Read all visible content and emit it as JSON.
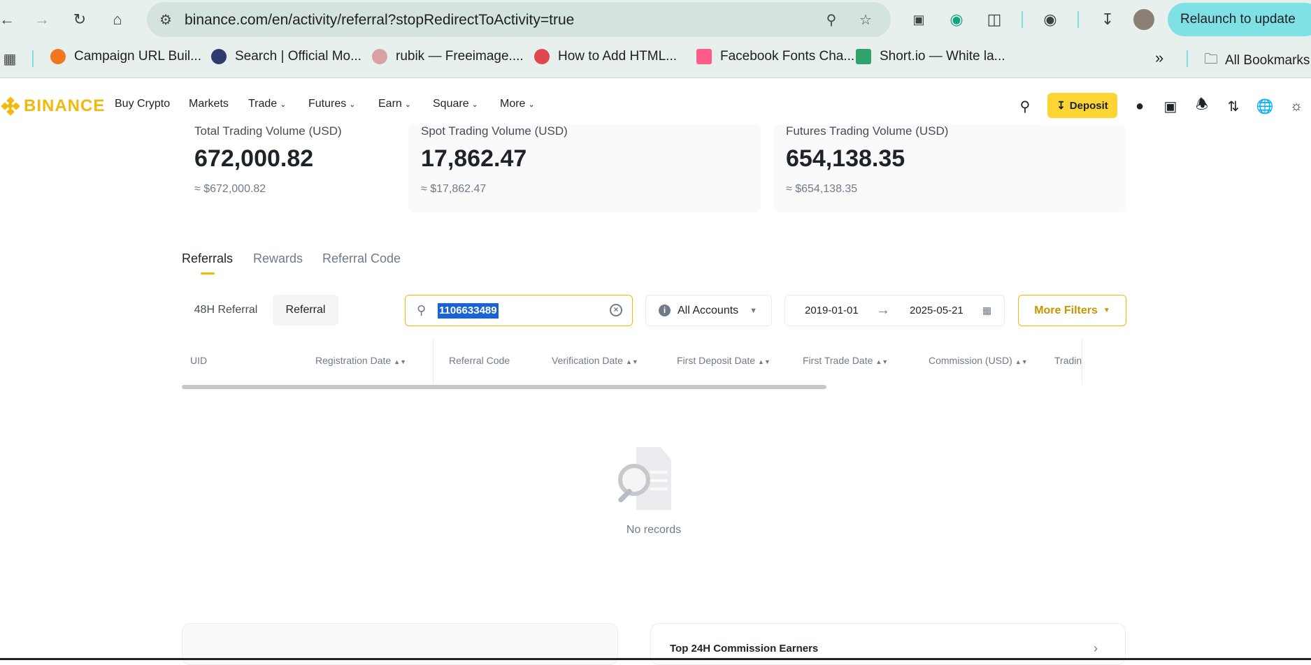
{
  "browser": {
    "url": "binance.com/en/activity/referral?stopRedirectToActivity=true",
    "relaunch_label": "Relaunch to update",
    "bookmarks": [
      "Campaign URL Buil...",
      "Search | Official Mo...",
      "rubik — Freeimage....",
      "How to Add HTML...",
      "Facebook Fonts Cha...",
      "Short.io — White la..."
    ],
    "all_bookmarks_label": "All Bookmarks",
    "overflow_label": "»"
  },
  "header": {
    "logo_text": "BINANCE",
    "nav": {
      "buy_crypto": "Buy Crypto",
      "markets": "Markets",
      "trade": "Trade",
      "futures": "Futures",
      "earn": "Earn",
      "square": "Square",
      "more": "More"
    },
    "deposit_label": "Deposit"
  },
  "stats": [
    {
      "label": "Total Trading Volume (USD)",
      "value": "672,000.82",
      "sub": "≈ $672,000.82"
    },
    {
      "label": "Spot Trading Volume (USD)",
      "value": "17,862.47",
      "sub": "≈ $17,862.47"
    },
    {
      "label": "Futures Trading Volume (USD)",
      "value": "654,138.35",
      "sub": "≈ $654,138.35"
    }
  ],
  "tabs": {
    "referrals": "Referrals",
    "rewards": "Rewards",
    "referral_code": "Referral Code"
  },
  "filters": {
    "seg_48h": "48H Referral",
    "seg_referral": "Referral",
    "search_value": "1106633489",
    "accounts": "All Accounts",
    "date_from": "2019-01-01",
    "date_arrow": "→",
    "date_to": "2025-05-21",
    "more_filters": "More Filters"
  },
  "table": {
    "columns": [
      "UID",
      "Registration Date",
      "Referral Code",
      "Verification Date",
      "First Deposit Date",
      "First Trade Date",
      "Commission (USD)",
      "Tradin"
    ]
  },
  "empty_state": {
    "text": "No records"
  },
  "bottom": {
    "top_earners_title": "Top 24H Commission Earners"
  },
  "colors": {
    "brand": "#f0b90b",
    "deposit_bg": "#fcd535",
    "selection": "#1a63d6"
  }
}
